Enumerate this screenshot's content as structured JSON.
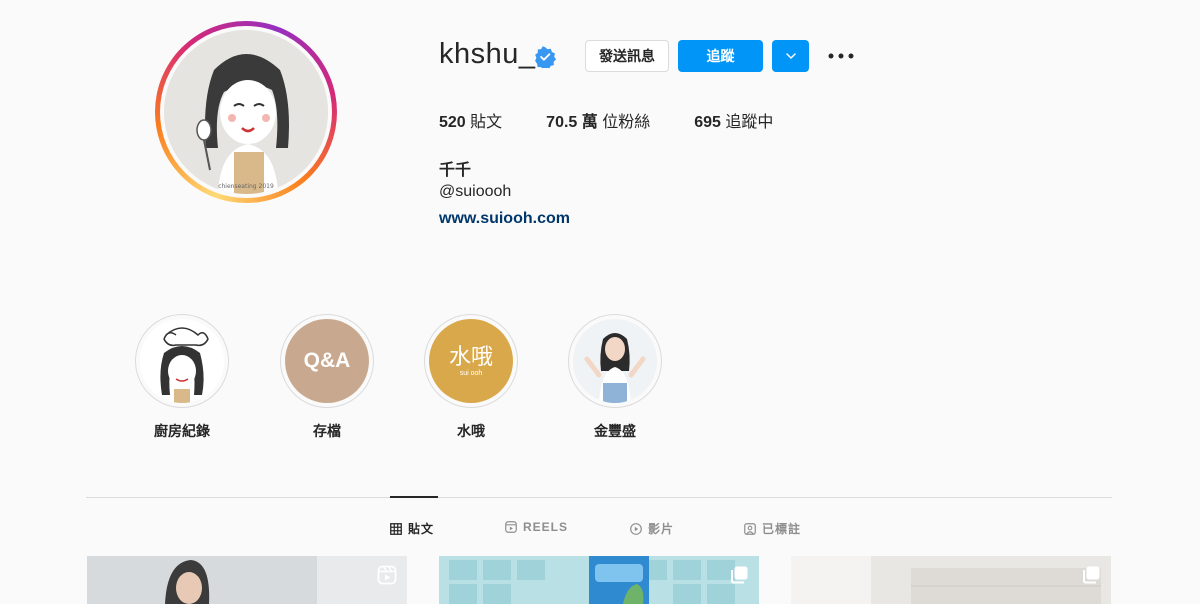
{
  "profile": {
    "username": "khshu_",
    "verified": true,
    "message_button": "發送訊息",
    "follow_button": "追蹤",
    "stats": [
      {
        "count": "520",
        "label": "貼文"
      },
      {
        "count": "70.5 萬",
        "label": "位粉絲"
      },
      {
        "count": "695",
        "label": "追蹤中"
      }
    ],
    "full_name": "千千",
    "handle": "@suioooh",
    "website": "www.suiooh.com",
    "avatar_watermark": "chienseating 2019"
  },
  "highlights": [
    {
      "label": "廚房紀錄"
    },
    {
      "label": "存檔",
      "cover_text": "Q&A"
    },
    {
      "label": "水哦",
      "cover_text": "水哦",
      "cover_subtext": "sui ooh"
    },
    {
      "label": "金豐盛"
    }
  ],
  "tabs": [
    {
      "label": "貼文",
      "icon": "grid-icon",
      "active": true
    },
    {
      "label": "REELS",
      "icon": "reels-icon",
      "active": false
    },
    {
      "label": "影片",
      "icon": "video-play-icon",
      "active": false
    },
    {
      "label": "已標註",
      "icon": "tagged-icon",
      "active": false
    }
  ],
  "colors": {
    "accent": "#0095f6",
    "link": "#00376b",
    "verified": "#3897f0"
  }
}
